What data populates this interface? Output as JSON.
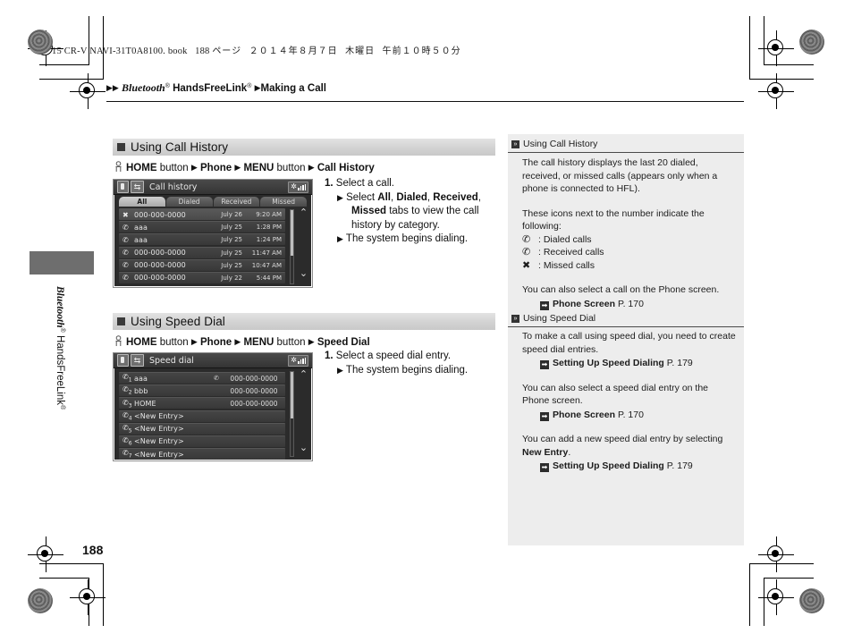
{
  "book_line": {
    "prefix": "15 CR-V NAVI-31T0A8100. book",
    "page": "188",
    "page_unit": "ページ",
    "date": "２０１４年８月７日",
    "weekday": "木曜日",
    "time": "午前１０時５０分"
  },
  "breadcrumb": {
    "arrow": "▶",
    "item1": "Bluetooth",
    "item1_sup": "®",
    "item2": "HandsFreeLink",
    "item2_sup": "®",
    "item3": "Making a Call"
  },
  "side": {
    "label_italic": "Bluetooth",
    "label_sup1": "®",
    "label_rest": " HandsFreeLink",
    "label_sup2": "®"
  },
  "page_number": "188",
  "sections": [
    {
      "heading": "Using Call History",
      "path": {
        "home": "HOME",
        "home_suffix": " button",
        "step2": "Phone",
        "step3": "MENU",
        "step3_suffix": " button",
        "step4": "Call History",
        "arrow": "▶"
      },
      "screen": {
        "title": "Call history",
        "back_glyph": "⇆",
        "tabs": [
          "All",
          "Dialed",
          "Received",
          "Missed"
        ],
        "selected_tab": "All",
        "rows": [
          {
            "icon": "missed",
            "name": "000-000-0000",
            "date": "July 26",
            "time": "9:20 AM",
            "highlight": true
          },
          {
            "icon": "dialed",
            "name": "aaa",
            "date": "July 25",
            "time": "1:28 PM",
            "highlight": false
          },
          {
            "icon": "dialed",
            "name": "aaa",
            "date": "July 25",
            "time": "1:24 PM",
            "highlight": false
          },
          {
            "icon": "dialed",
            "name": "000-000-0000",
            "date": "July 25",
            "time": "11:47 AM",
            "highlight": false
          },
          {
            "icon": "dialed",
            "name": "000-000-0000",
            "date": "July 25",
            "time": "10:47 AM",
            "highlight": false
          },
          {
            "icon": "dialed",
            "name": "000-000-0000",
            "date": "July 22",
            "time": "5:44 PM",
            "highlight": false
          }
        ],
        "scroll_up": "⌃",
        "scroll_down": "⌄"
      },
      "steps": {
        "num": "1.",
        "text": "Select a call.",
        "bullets": [
          "Select All, Dialed, Received, Missed tabs to view the call history by category.",
          "The system begins dialing."
        ]
      }
    },
    {
      "heading": "Using Speed Dial",
      "path": {
        "home": "HOME",
        "home_suffix": " button",
        "step2": "Phone",
        "step3": "MENU",
        "step3_suffix": " button",
        "step4": "Speed Dial",
        "arrow": "▶"
      },
      "screen": {
        "title": "Speed dial",
        "back_glyph": "⇆",
        "rows": [
          {
            "index": "1",
            "name": "aaa",
            "mid": "✆",
            "number": "000-000-0000"
          },
          {
            "index": "2",
            "name": "bbb",
            "mid": "",
            "number": "000-000-0000"
          },
          {
            "index": "3",
            "name": "HOME",
            "mid": "",
            "number": "000-000-0000"
          },
          {
            "index": "4",
            "name": "<New Entry>",
            "mid": "",
            "number": ""
          },
          {
            "index": "5",
            "name": "<New Entry>",
            "mid": "",
            "number": ""
          },
          {
            "index": "6",
            "name": "<New Entry>",
            "mid": "",
            "number": ""
          },
          {
            "index": "7",
            "name": "<New Entry>",
            "mid": "",
            "number": ""
          }
        ],
        "scroll_up": "⌃",
        "scroll_down": "⌄"
      },
      "steps": {
        "num": "1.",
        "text": "Select a speed dial entry.",
        "bullets": [
          "The system begins dialing."
        ]
      }
    }
  ],
  "notes": {
    "block1": {
      "heading": "Using Call History",
      "p1": "The call history displays the last 20 dialed, received, or missed calls (appears only when a phone is connected to HFL).",
      "p2": "These icons next to the number indicate the following:",
      "icons": [
        {
          "glyph": "dialed",
          "label": ": Dialed calls"
        },
        {
          "glyph": "received",
          "label": ": Received calls"
        },
        {
          "glyph": "missed",
          "label": ": Missed calls"
        }
      ],
      "p3": "You can also select a call on the Phone screen.",
      "ref1_bold": "Phone Screen",
      "ref1_page": " P. 170"
    },
    "block2": {
      "heading": "Using Speed Dial",
      "p1": "To make a call using speed dial, you need to create speed dial entries.",
      "ref1_bold": "Setting Up Speed Dialing",
      "ref1_page": " P. 179",
      "p2": "You can also select a speed dial entry on the Phone screen.",
      "ref2_bold": "Phone Screen",
      "ref2_page": " P. 170",
      "p3_pre": "You can add a new speed dial entry by selecting ",
      "p3_bold": "New Entry",
      "p3_post": ".",
      "ref3_bold": "Setting Up Speed Dialing",
      "ref3_page": " P. 179"
    }
  }
}
